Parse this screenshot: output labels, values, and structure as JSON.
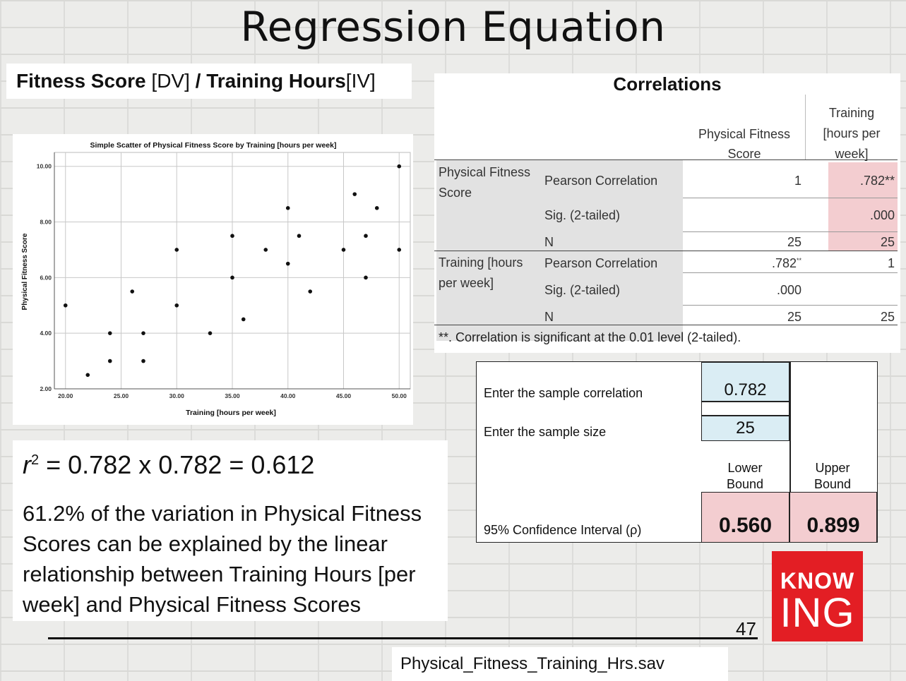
{
  "slide": {
    "title": "Regression Equation",
    "page_number": "47",
    "filename": "Physical_Fitness_Training_Hrs.sav"
  },
  "subtitle": {
    "part1_bold": "Fitness Score",
    "part2": " [DV] ",
    "part3_bold": "/ Training Hours",
    "part4": "[IV]"
  },
  "chart_data": {
    "type": "scatter",
    "title": "Simple Scatter of Physical Fitness Score by Training [hours per week]",
    "xlabel": "Training [hours per week]",
    "ylabel": "Physical Fitness Score",
    "xlim": [
      19,
      51
    ],
    "ylim": [
      2,
      10.5
    ],
    "x_ticks": [
      20,
      25,
      30,
      35,
      40,
      45,
      50
    ],
    "x_tick_labels": [
      "20.00",
      "25.00",
      "30.00",
      "35.00",
      "40.00",
      "45.00",
      "50.00"
    ],
    "y_ticks": [
      2,
      4,
      6,
      8,
      10
    ],
    "y_tick_labels": [
      "2.00",
      "4.00",
      "6.00",
      "8.00",
      "10.00"
    ],
    "grid": true,
    "points": [
      [
        20,
        5
      ],
      [
        22,
        2.5
      ],
      [
        24,
        4
      ],
      [
        24,
        3
      ],
      [
        26,
        5.5
      ],
      [
        27,
        4
      ],
      [
        27,
        3
      ],
      [
        30,
        7
      ],
      [
        30,
        5
      ],
      [
        33,
        4
      ],
      [
        35,
        7.5
      ],
      [
        35,
        6
      ],
      [
        36,
        4.5
      ],
      [
        38,
        7
      ],
      [
        40,
        8.5
      ],
      [
        40,
        6.5
      ],
      [
        41,
        7.5
      ],
      [
        42,
        5.5
      ],
      [
        45,
        7
      ],
      [
        46,
        9
      ],
      [
        47,
        7.5
      ],
      [
        47,
        6
      ],
      [
        48,
        8.5
      ],
      [
        50,
        10
      ],
      [
        50,
        7
      ]
    ]
  },
  "correlations": {
    "title": "Correlations",
    "col1": "Physical Fitness Score",
    "col2": "Training [hours per week]",
    "row1_label": "Physical Fitness Score",
    "row2_label": "Training [hours per week]",
    "stat_pearson": "Pearson Correlation",
    "stat_sig": "Sig. (2-tailed)",
    "stat_n": "N",
    "r1_pearson_c1": "1",
    "r1_pearson_c2": ".782**",
    "r1_sig_c2": ".000",
    "r1_n_c1": "25",
    "r1_n_c2": "25",
    "r2_pearson_c1": ".782",
    "r2_pearson_c1_sup": "**",
    "r2_pearson_c2": "1",
    "r2_sig_c1": ".000",
    "r2_n_c1": "25",
    "r2_n_c2": "25",
    "footnote": "**. Correlation is significant at the 0.01 level (2-tailed)."
  },
  "r_squared": {
    "r": "r",
    "sup": "2",
    "equation": " = 0.782 x 0.782 = 0.612",
    "explanation": "61.2% of the variation in Physical Fitness Scores can be explained by the linear relationship between Training Hours [per week] and Physical Fitness Scores"
  },
  "ci_calculator": {
    "label_corr": "Enter the sample correlation",
    "value_corr": "0.782",
    "label_n": "Enter the sample size",
    "value_n": "25",
    "lower_label": "Lower Bound",
    "upper_label": "Upper Bound",
    "ci_label": "95% Confidence Interval (ρ)",
    "lower_value": "0.560",
    "upper_value": "0.899"
  },
  "logo": {
    "line1": "KNOW",
    "line2": "ING"
  },
  "colors": {
    "highlight_pink": "#f3cdd0",
    "input_blue": "#daedf4",
    "logo_red": "#e31e24"
  }
}
